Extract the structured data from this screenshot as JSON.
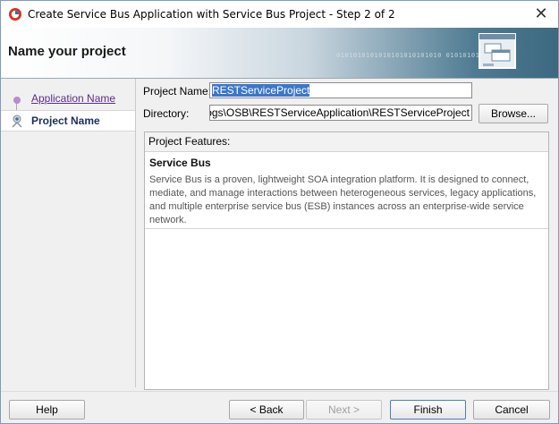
{
  "window": {
    "title": "Create Service Bus Application with Service Bus Project - Step 2 of 2",
    "close_glyph": "✕"
  },
  "banner": {
    "title": "Name your project",
    "decoration_text": "0101010101010101010101010  01010101010",
    "icon": "window-dialog-icon"
  },
  "nav": {
    "items": [
      {
        "label": "Application Name",
        "state": "visited",
        "icon": "step-dot-icon"
      },
      {
        "label": "Project Name",
        "state": "active",
        "icon": "step-active-icon"
      }
    ]
  },
  "form": {
    "project_name_label": "Project Name:",
    "project_name_value": "RESTServiceProject",
    "directory_label": "Directory:",
    "directory_value": "ankur\\Blogs\\OSB\\RESTServiceApplication\\RESTServiceProject",
    "browse_label": "Browse..."
  },
  "features": {
    "header": "Project Features:",
    "title": "Service Bus",
    "description": "Service Bus is a proven, lightweight SOA integration platform. It is designed to connect, mediate, and manage interactions between heterogeneous services, legacy applications, and multiple enterprise service bus (ESB) instances across an enterprise-wide service network."
  },
  "footer": {
    "help_label": "Help",
    "back_label": "< Back",
    "next_label": "Next >",
    "finish_label": "Finish",
    "cancel_label": "Cancel"
  },
  "colors": {
    "accent": "#3b77c9",
    "link": "#5a2e8a",
    "banner_dark": "#3c6880"
  }
}
